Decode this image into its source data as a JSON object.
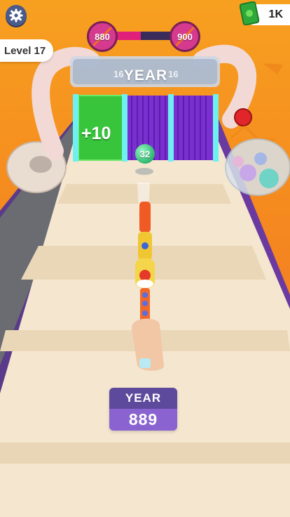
{
  "hud": {
    "settings_icon": "gear-icon",
    "level_text": "Level 17",
    "cash_text": "1K",
    "cash_icon": "money-bill-icon"
  },
  "progress": {
    "start_year": "880",
    "end_year": "900",
    "fill_fraction": 0.45,
    "accent_color": "#e0207a"
  },
  "gate": {
    "label": "YEAR",
    "side_number_left": "16",
    "side_number_right": "16",
    "bonus_label": "+10"
  },
  "ammo": {
    "ball_value": "32"
  },
  "year_counter": {
    "label": "YEAR",
    "value": "889"
  }
}
